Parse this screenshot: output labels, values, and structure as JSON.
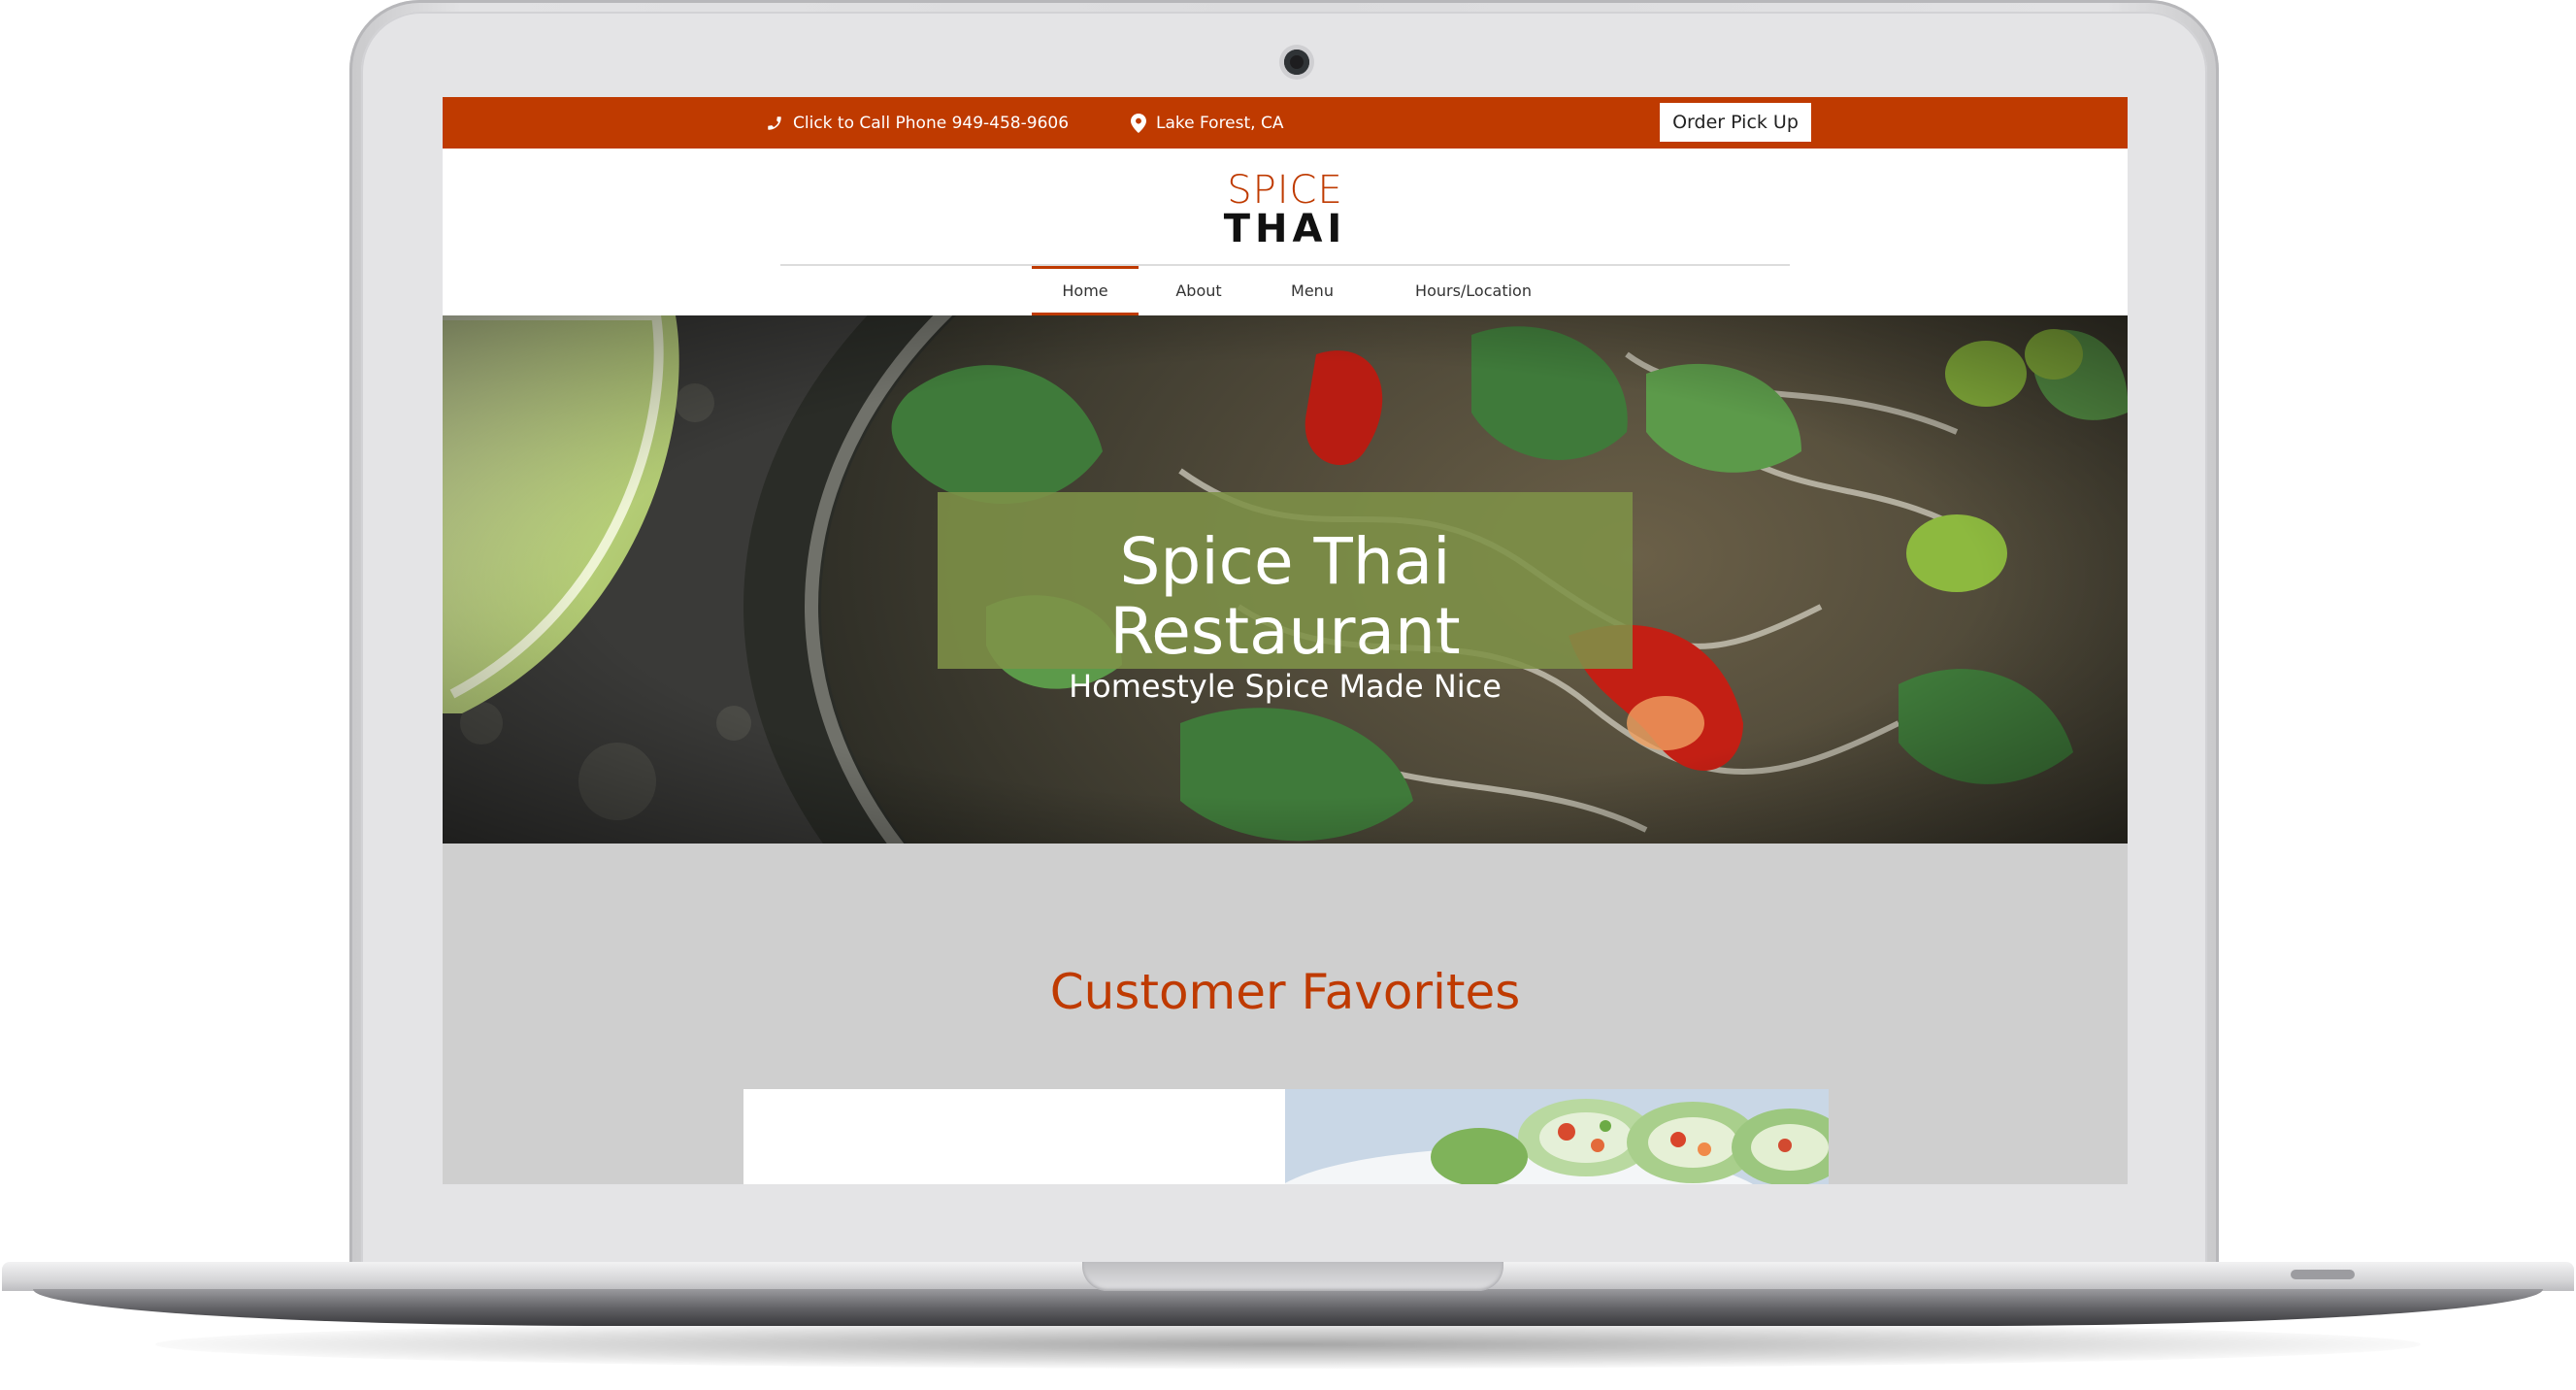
{
  "topbar": {
    "phone_label": "Click to Call Phone 949-458-9606",
    "location_label": "Lake Forest, CA",
    "order_button": "Order Pick Up",
    "phone_icon": "phone-icon",
    "location_icon": "map-pin-icon"
  },
  "logo": {
    "line1": "SPICE",
    "line2": "THAI"
  },
  "nav": {
    "items": [
      {
        "label": "Home",
        "active": true
      },
      {
        "label": "About",
        "active": false
      },
      {
        "label": "Menu",
        "active": false
      },
      {
        "label": "Hours/Location",
        "active": false
      }
    ]
  },
  "hero": {
    "title": "Spice Thai Restaurant",
    "subtitle": "Homestyle Spice Made Nice"
  },
  "favorites": {
    "heading": "Customer Favorites"
  },
  "colors": {
    "brand": "#bf3a00",
    "hero_box": "#7e9248",
    "page_bg": "#cfcfcf"
  }
}
